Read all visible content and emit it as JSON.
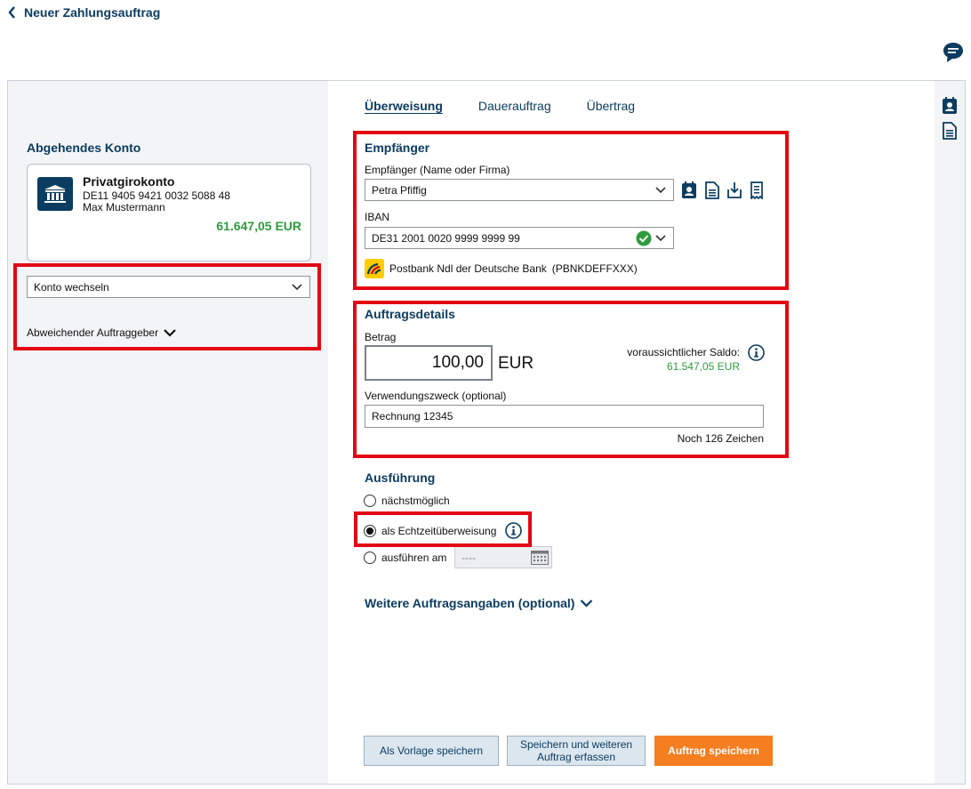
{
  "header": {
    "back_title": "Neuer Zahlungsauftrag"
  },
  "left": {
    "section_title": "Abgehendes Konto",
    "account": {
      "name": "Privatgirokonto",
      "iban": "DE11 9405 9421 0032 5088 48",
      "owner": "Max Mustermann",
      "balance": "61.647,05 EUR"
    },
    "switch_account": "Konto wechseln",
    "different_payer": "Abweichender Auftraggeber"
  },
  "tabs": [
    {
      "label": "Überweisung",
      "active": true
    },
    {
      "label": "Dauerauftrag",
      "active": false
    },
    {
      "label": "Übertrag",
      "active": false
    }
  ],
  "recipient": {
    "title": "Empfänger",
    "name_label": "Empfänger (Name oder Firma)",
    "name_value": "Petra Pfiffig",
    "iban_label": "IBAN",
    "iban_value": "DE31 2001 0020 9999 9999 99",
    "bank_name": "Postbank Ndl der Deutsche Bank",
    "bic": "(PBNKDEFFXXX)"
  },
  "details": {
    "title": "Auftragsdetails",
    "amount_label": "Betrag",
    "amount_value": "100,00",
    "currency": "EUR",
    "saldo_label": "voraussichtlicher Saldo:",
    "saldo_value": "61.547,05 EUR",
    "purpose_label": "Verwendungszweck (optional)",
    "purpose_value": "Rechnung 12345",
    "chars_left": "Noch 126 Zeichen"
  },
  "execution": {
    "title": "Ausführung",
    "opt_asap": "nächstmöglich",
    "opt_instant": "als Echtzeitüberweisung",
    "opt_date": "ausführen am",
    "date_placeholder": "----",
    "selected": "instant"
  },
  "more_details": "Weitere Auftragsangaben (optional)",
  "buttons": {
    "save_template": "Als Vorlage speichern",
    "save_and_new": "Speichern und weiteren Auftrag erfassen",
    "save_order": "Auftrag speichern"
  },
  "colors": {
    "brand_dark_blue": "#0c3c60",
    "positive_green": "#2e9a3d",
    "highlight_red": "#e30613",
    "primary_orange": "#f57e20"
  }
}
